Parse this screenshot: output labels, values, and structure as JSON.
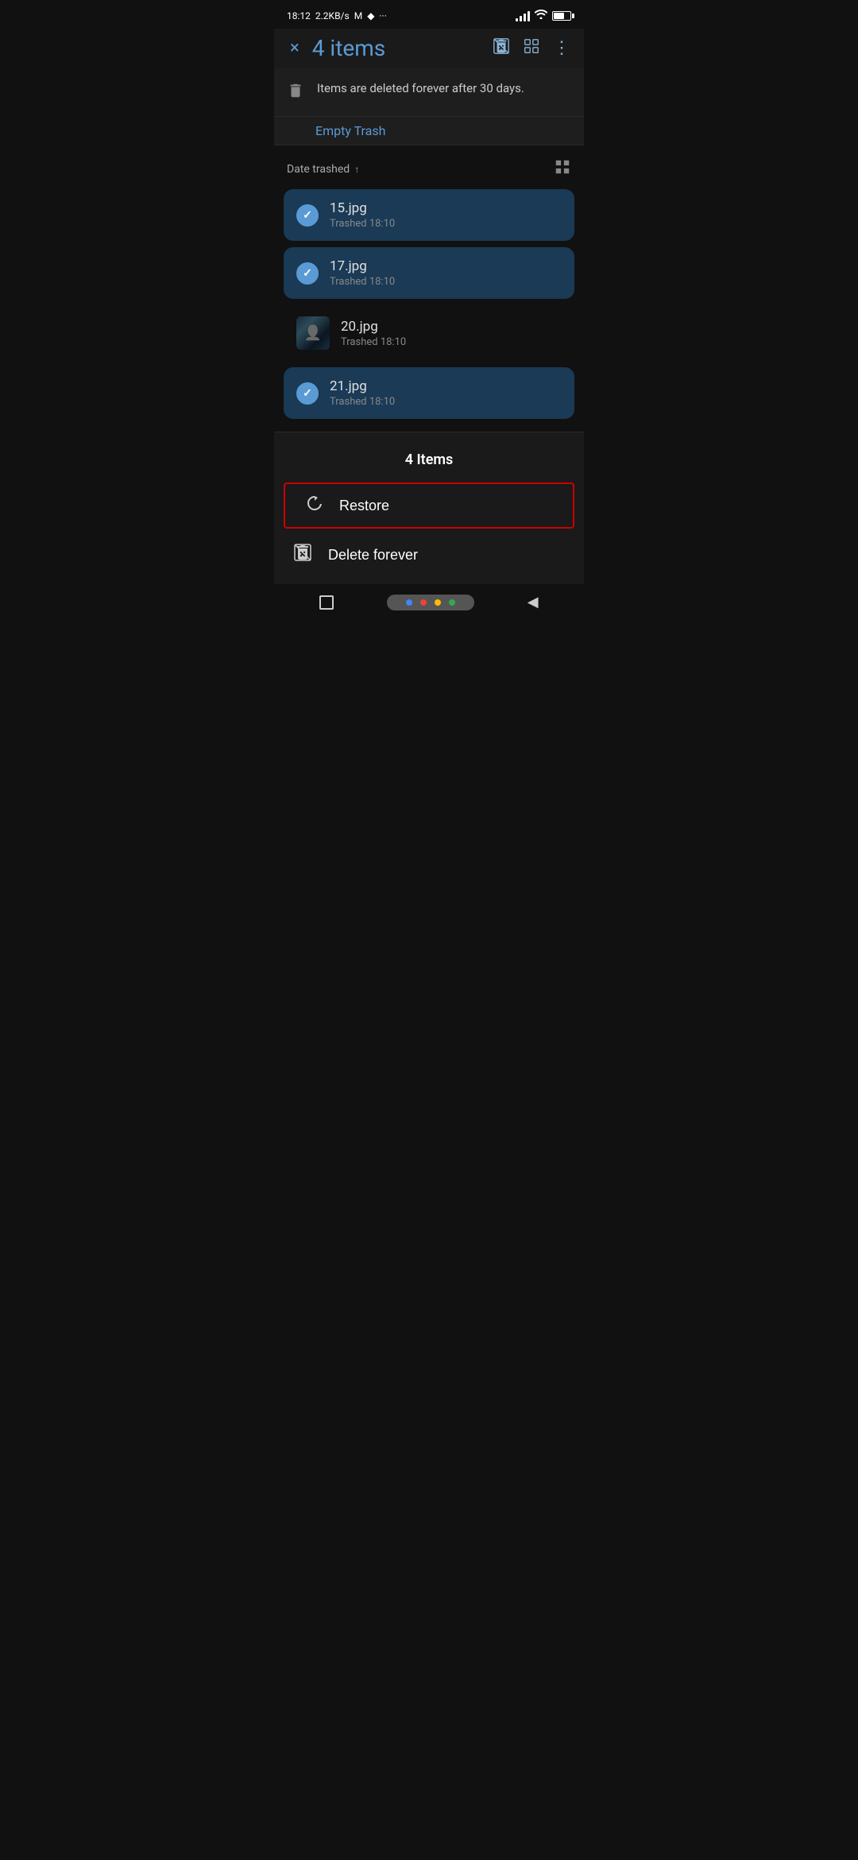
{
  "statusBar": {
    "time": "18:12",
    "speed": "2.2KB/s",
    "icons": [
      "gmail",
      "location",
      "more"
    ]
  },
  "toolbar": {
    "title": "4 items",
    "closeLabel": "×",
    "deleteForeverIconTitle": "delete-forever-icon",
    "selectAllIconTitle": "select-all-icon",
    "moreIconTitle": "more-options-icon"
  },
  "infoBanner": {
    "text": "Items are deleted forever after 30 days.",
    "iconLabel": "trash-icon"
  },
  "emptyTrashLabel": "Empty Trash",
  "sortBar": {
    "label": "Date trashed",
    "arrow": "↑",
    "gridIconLabel": "grid-view-icon"
  },
  "files": [
    {
      "name": "15.jpg",
      "meta": "Trashed 18:10",
      "selected": true,
      "hasThumb": false
    },
    {
      "name": "17.jpg",
      "meta": "Trashed 18:10",
      "selected": true,
      "hasThumb": false
    },
    {
      "name": "20.jpg",
      "meta": "Trashed 18:10",
      "selected": false,
      "hasThumb": true
    },
    {
      "name": "21.jpg",
      "meta": "Trashed 18:10",
      "selected": true,
      "hasThumb": false
    }
  ],
  "selectionBar": {
    "countLabel": "4 Items",
    "restoreLabel": "Restore",
    "deleteForeverLabel": "Delete forever",
    "restoreIconLabel": "restore-icon",
    "deleteIconLabel": "delete-forever-small-icon"
  },
  "navBar": {
    "homeIconLabel": "home-icon",
    "dots": [
      {
        "color": "#4285F4"
      },
      {
        "color": "#EA4335"
      },
      {
        "color": "#FBBC05"
      },
      {
        "color": "#34A853"
      }
    ],
    "backIconLabel": "back-icon"
  }
}
